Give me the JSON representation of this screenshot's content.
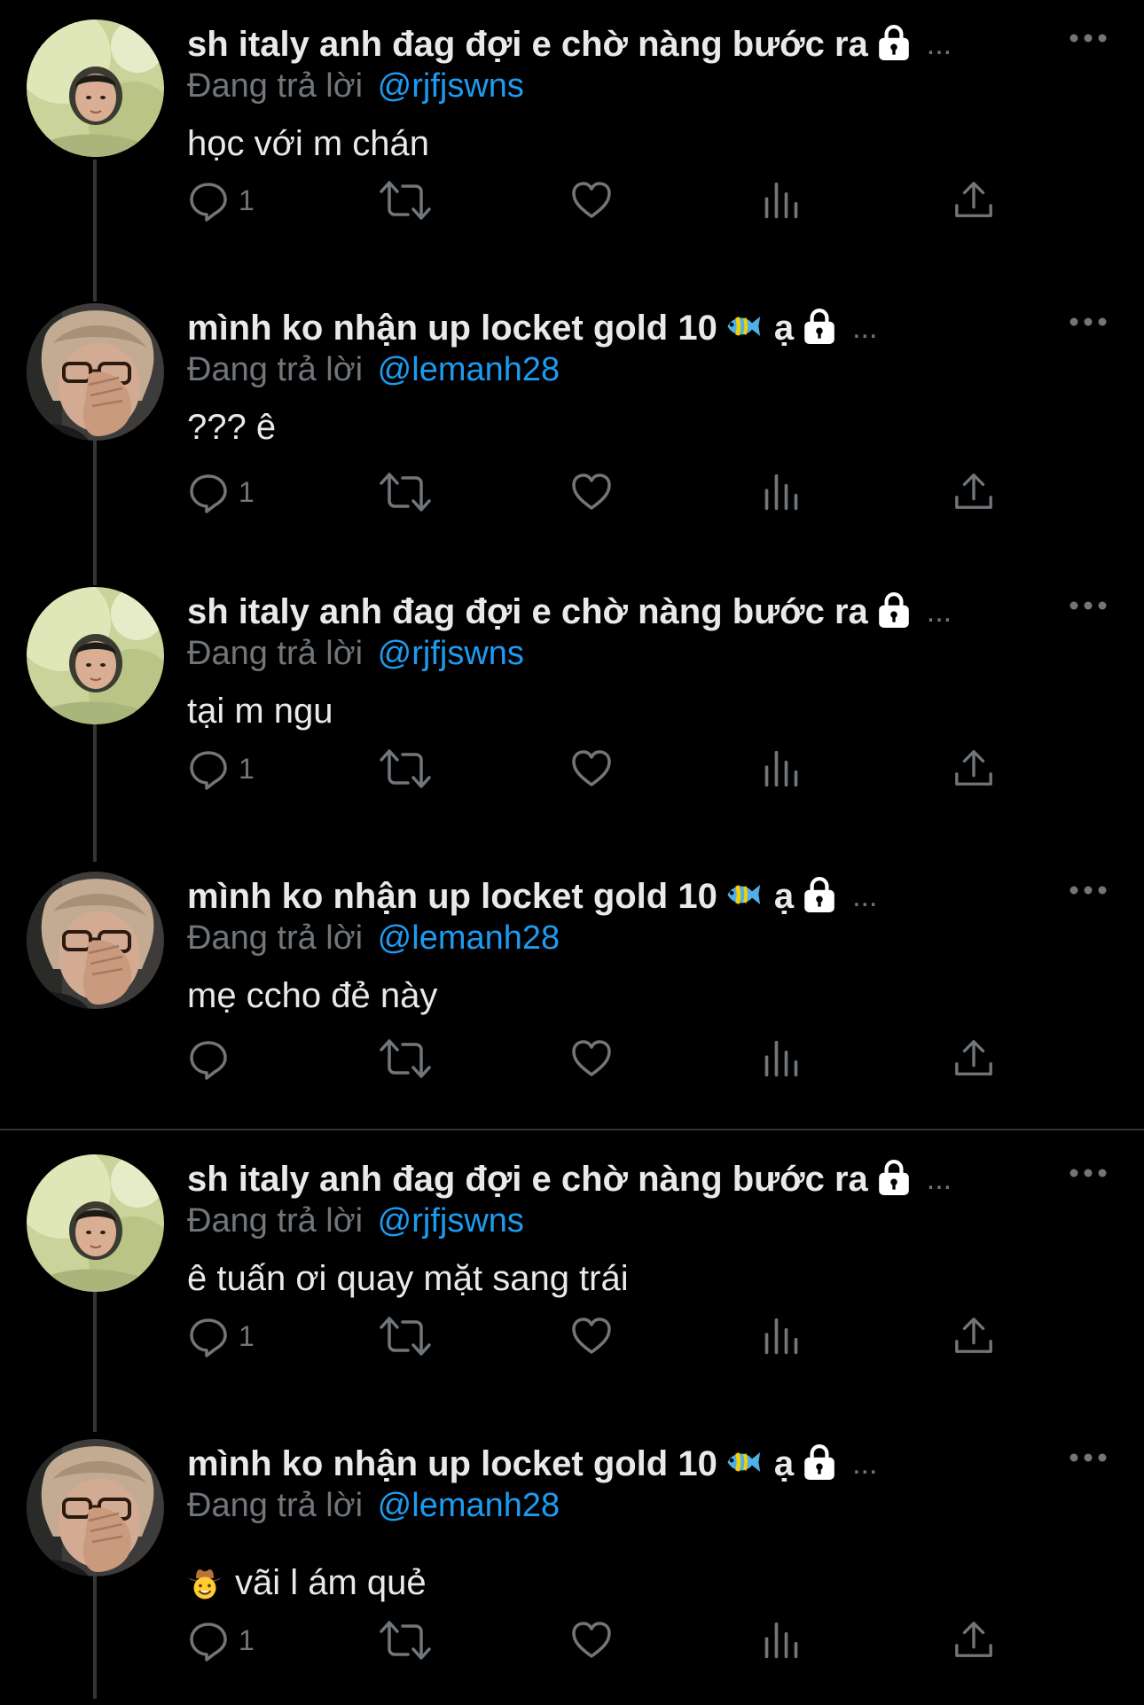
{
  "reply_prefix": "Đang trả lời",
  "colors": {
    "background": "#000000",
    "text": "#e7e9ea",
    "secondary": "#71767b",
    "link": "#1d9bf0",
    "line": "#333639"
  },
  "icons": [
    "reply-icon",
    "retweet-icon",
    "like-icon",
    "views-icon",
    "share-icon",
    "more-icon",
    "lock-icon",
    "fish-emoji-icon",
    "cowboy-emoji-icon"
  ],
  "tweets": [
    {
      "name": "sh italy anh đag đợi e chờ nàng bước ra",
      "name_suffix": "",
      "ellipsis": "...",
      "handle": "@rjfjswns",
      "text": "học với m chán",
      "reply_count": "1"
    },
    {
      "name": "mình ko nhận up locket gold 10",
      "name_suffix": "ạ",
      "ellipsis": "...",
      "handle": "@lemanh28",
      "text": "??? ê",
      "reply_count": "1"
    },
    {
      "name": "sh italy anh đag đợi e chờ nàng bước ra",
      "name_suffix": "",
      "ellipsis": "...",
      "handle": "@rjfjswns",
      "text": "tại m ngu",
      "reply_count": "1"
    },
    {
      "name": "mình ko nhận up locket gold 10",
      "name_suffix": "ạ",
      "ellipsis": "...",
      "handle": "@lemanh28",
      "text": "mẹ ccho đẻ này",
      "reply_count": ""
    },
    {
      "name": "sh italy anh đag đợi e chờ nàng bước ra",
      "name_suffix": "",
      "ellipsis": "...",
      "handle": "@rjfjswns",
      "text": "ê tuấn ơi quay mặt sang trái",
      "reply_count": "1"
    },
    {
      "name": "mình ko nhận up locket gold 10",
      "name_suffix": "ạ",
      "ellipsis": "...",
      "handle": "@lemanh28",
      "text": "vãi l ám quẻ",
      "reply_count": "1"
    }
  ]
}
